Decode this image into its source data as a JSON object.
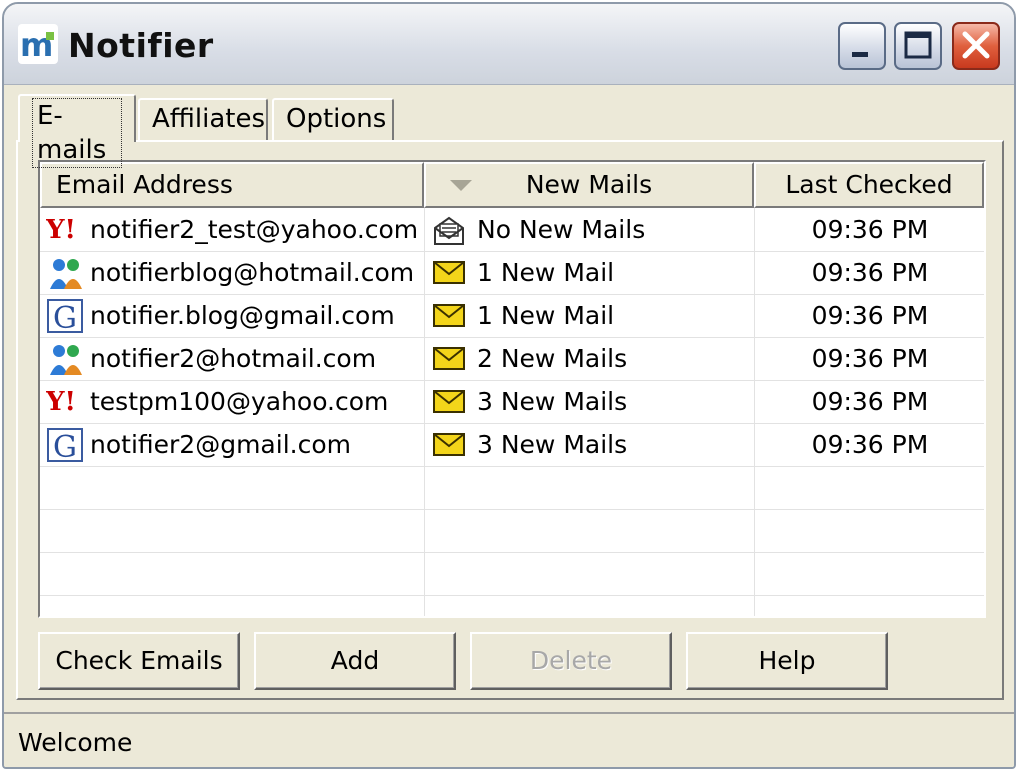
{
  "window": {
    "title": "Notifier",
    "app_icon": "notifier-logo",
    "controls": [
      "minimize-icon",
      "maximize-icon",
      "close-icon"
    ]
  },
  "tabs": [
    {
      "label": "E-mails",
      "active": true
    },
    {
      "label": "Affiliates",
      "active": false
    },
    {
      "label": "Options",
      "active": false
    }
  ],
  "table": {
    "columns": {
      "email": "Email Address",
      "new_mails": "New Mails",
      "last_checked": "Last Checked"
    },
    "sort_icon": "sort-down-icon",
    "rows": [
      {
        "provider_icon": "yahoo-icon",
        "email": "notifier2_test@yahoo.com",
        "status_icon": "open-envelope-icon",
        "new_mails": "No New Mails",
        "last_checked": "09:36 PM"
      },
      {
        "provider_icon": "hotmail-icon",
        "email": "notifierblog@hotmail.com",
        "status_icon": "envelope-icon",
        "new_mails": "1 New Mail",
        "last_checked": "09:36 PM"
      },
      {
        "provider_icon": "gmail-icon",
        "email": "notifier.blog@gmail.com",
        "status_icon": "envelope-icon",
        "new_mails": "1 New Mail",
        "last_checked": "09:36 PM"
      },
      {
        "provider_icon": "hotmail-icon",
        "email": "notifier2@hotmail.com",
        "status_icon": "envelope-icon",
        "new_mails": "2 New Mails",
        "last_checked": "09:36 PM"
      },
      {
        "provider_icon": "yahoo-icon",
        "email": "testpm100@yahoo.com",
        "status_icon": "envelope-icon",
        "new_mails": "3 New Mails",
        "last_checked": "09:36 PM"
      },
      {
        "provider_icon": "gmail-icon",
        "email": "notifier2@gmail.com",
        "status_icon": "envelope-icon",
        "new_mails": "3 New Mails",
        "last_checked": "09:36 PM"
      }
    ]
  },
  "buttons": {
    "check": "Check Emails",
    "add": "Add",
    "delete": "Delete",
    "help": "Help"
  },
  "status": {
    "text": "Welcome"
  },
  "colors": {
    "window_bg": "#ece9d8",
    "close_red": "#d84f30",
    "envelope_yellow": "#f3d51a",
    "yahoo_red": "#cc0000"
  }
}
